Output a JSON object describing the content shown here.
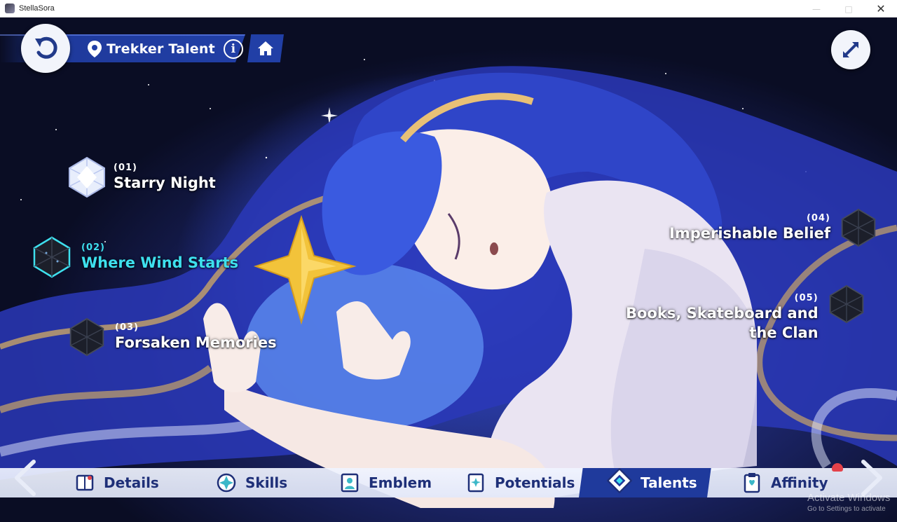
{
  "window": {
    "title": "StellaSora"
  },
  "header": {
    "title": "Trekker Talent",
    "info_symbol": "i"
  },
  "talents": [
    {
      "num": "(01)",
      "name": "Starry Night"
    },
    {
      "num": "(02)",
      "name": "Where Wind Starts",
      "state": "active"
    },
    {
      "num": "(03)",
      "name": "Forsaken Memories"
    },
    {
      "num": "(04)",
      "name": "Imperishable Belief"
    },
    {
      "num": "(05)",
      "name_line1": "Books, Skateboard and",
      "name_line2": "the Clan"
    }
  ],
  "tabs": [
    {
      "label": "Details",
      "icon": "book-icon"
    },
    {
      "label": "Skills",
      "icon": "compass-star-icon"
    },
    {
      "label": "Emblem",
      "icon": "portrait-icon"
    },
    {
      "label": "Potentials",
      "icon": "card-icon"
    },
    {
      "label": "Talents",
      "icon": "diamond-icon",
      "state": "active"
    },
    {
      "label": "Affinity",
      "icon": "clipboard-icon"
    }
  ],
  "watermark": {
    "line1": "Activate Windows",
    "line2": "Go to Settings to activate"
  },
  "colors": {
    "accent_blue": "#1f3a9c",
    "active_cyan": "#3ee0ee",
    "tab_text": "#1e2f78",
    "star_gold": "#f2c33a"
  }
}
